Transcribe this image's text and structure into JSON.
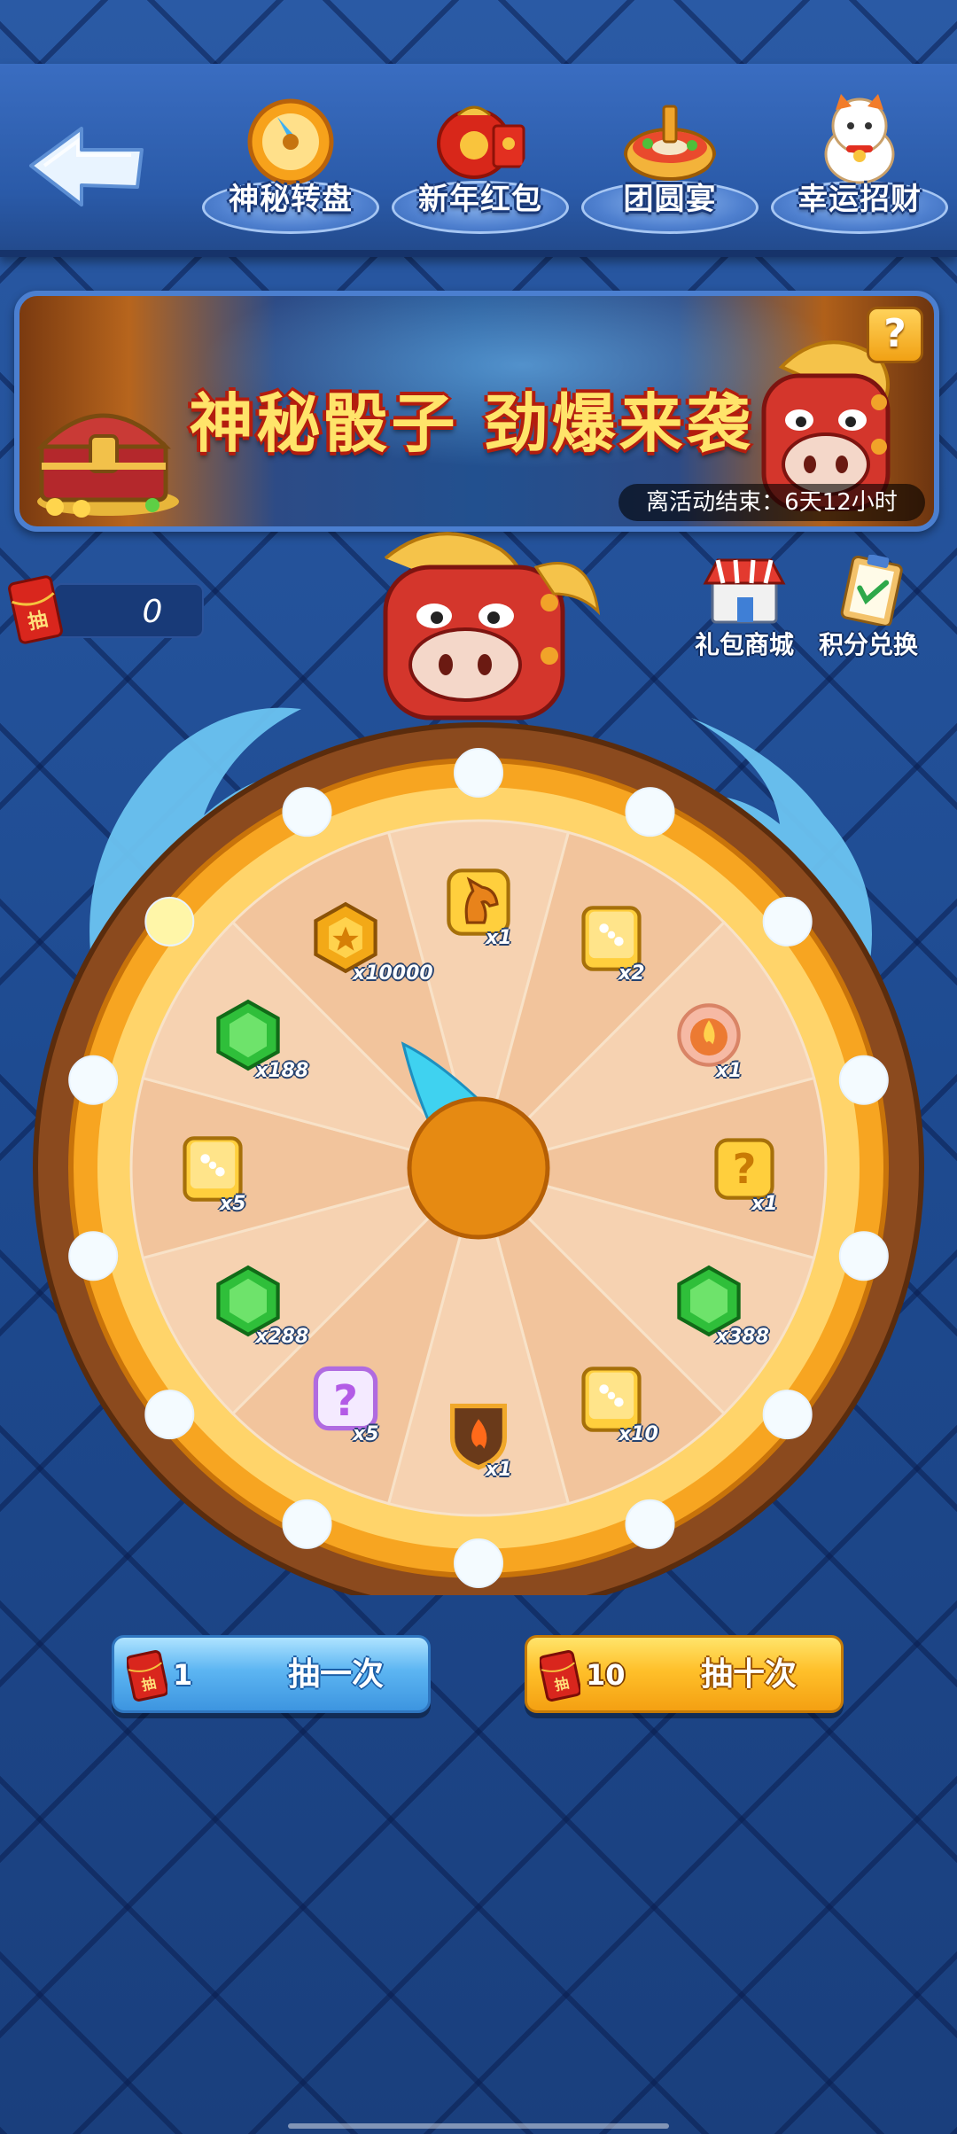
{
  "nav": {
    "back_icon": "back-arrow-icon",
    "tabs": [
      {
        "label": "神秘转盘",
        "icon": "wheel-compass-icon"
      },
      {
        "label": "新年红包",
        "icon": "red-envelope-icon"
      },
      {
        "label": "团圆宴",
        "icon": "hotpot-icon"
      },
      {
        "label": "幸运招财",
        "icon": "lucky-cat-icon"
      }
    ]
  },
  "banner": {
    "title": "神秘骰子  劲爆来袭",
    "help_label": "?",
    "timer": "离活动结束：6天12小时"
  },
  "tickets": {
    "count": "0",
    "icon_label": "抽"
  },
  "side_buttons": {
    "shop": "礼包商城",
    "exchange": "积分兑换"
  },
  "wheel": {
    "prizes": [
      {
        "icon": "horse-card-icon",
        "label": "x1"
      },
      {
        "icon": "dice-icon",
        "label": "x2"
      },
      {
        "icon": "flame-badge-icon",
        "label": "x1"
      },
      {
        "icon": "mystery-dice-icon",
        "label": "x1"
      },
      {
        "icon": "green-gem-icon",
        "label": "x388"
      },
      {
        "icon": "dice-icon",
        "label": "x10"
      },
      {
        "icon": "fire-shield-icon",
        "label": "x1"
      },
      {
        "icon": "purple-mystery-icon",
        "label": "x5"
      },
      {
        "icon": "green-gem-icon",
        "label": "x288"
      },
      {
        "icon": "dice-icon",
        "label": "x5"
      },
      {
        "icon": "green-gem-icon",
        "label": "x188"
      },
      {
        "icon": "gold-coin-icon",
        "label": "x10000"
      }
    ]
  },
  "actions": {
    "once": {
      "cost": "1",
      "label": "抽一次",
      "ticket_label": "抽"
    },
    "ten": {
      "cost": "10",
      "label": "抽十次",
      "ticket_label": "抽"
    }
  }
}
